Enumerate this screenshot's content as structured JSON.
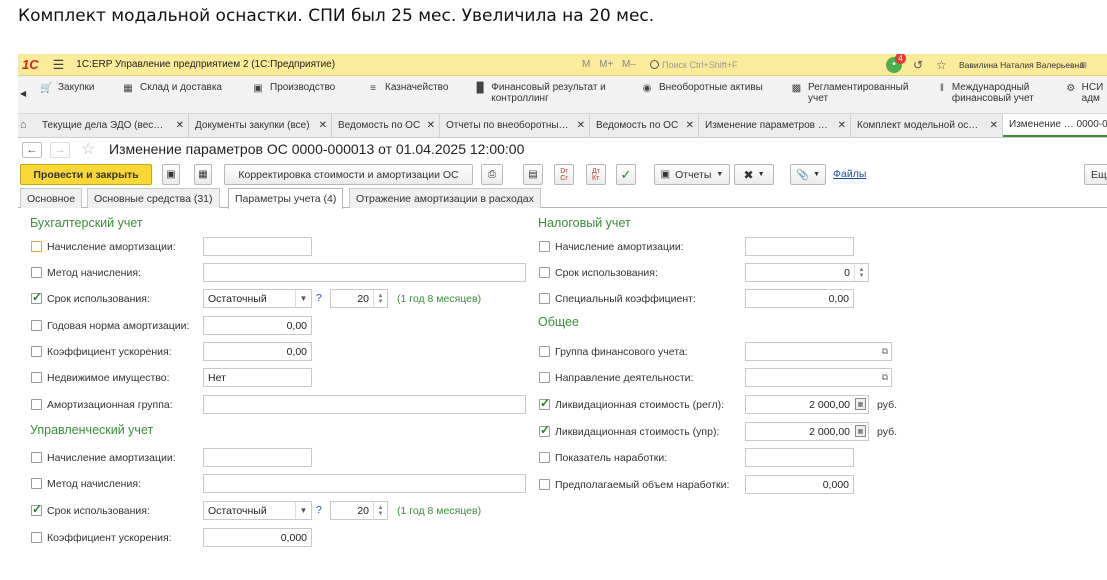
{
  "caption": "Комплект модальной оснастки. СПИ был 25 мес. Увеличила на 20 мес.",
  "topbar": {
    "logo": "1С",
    "menu_icon": "hamburger-icon",
    "title": "1С:ERP Управление предприятием 2  (1С:Предприятие)",
    "m_buttons": "M  M+  M–",
    "search_placeholder": "Поиск Ctrl+Shift+F",
    "notifications_count": "4",
    "user_name": "Вавилина Наталия Валерьевна"
  },
  "sections": [
    {
      "icon": "cart-icon",
      "label": "Закупки"
    },
    {
      "icon": "warehouse-icon",
      "label": "Склад и доставка"
    },
    {
      "icon": "factory-icon",
      "label": "Производство"
    },
    {
      "icon": "treasury-icon",
      "label": "Казначейство"
    },
    {
      "icon": "chart-icon",
      "label": "Финансовый результат и контроллинг"
    },
    {
      "icon": "car-icon",
      "label": "Внеоборотные активы"
    },
    {
      "icon": "report-icon",
      "label": "Регламентированный учет"
    },
    {
      "icon": "dr-cr-icon",
      "label": "Международный финансовый учет"
    },
    {
      "icon": "gear-icon",
      "label": "НСИ адм"
    }
  ],
  "open_tabs": [
    {
      "label": "Текущие дела ЭДО (вес…"
    },
    {
      "label": "Документы закупки (все)"
    },
    {
      "label": "Ведомость по ОС"
    },
    {
      "label": "Отчеты по внеоборотны…"
    },
    {
      "label": "Ведомость по ОС"
    },
    {
      "label": "Изменение параметров …"
    },
    {
      "label": "Комплект модельной ос…"
    },
    {
      "label": "Изменение … 0000-0"
    }
  ],
  "form": {
    "title": "Изменение параметров ОС 0000-000013 от 01.04.2025 12:00:00",
    "post_close": "Провести и закрыть",
    "correction": "Корректировка стоимости и амортизации ОС",
    "reports": "Отчеты",
    "files": "Файлы",
    "more": "Ещ",
    "tabs": [
      "Основное",
      "Основные средства (31)",
      "Параметры учета (4)",
      "Отражение амортизации в расходах"
    ]
  },
  "accounting": {
    "header": "Бухгалтерский учет",
    "depreciation": {
      "label": "Начисление амортизации:",
      "value": "",
      "checked": false
    },
    "method": {
      "label": "Метод начисления:",
      "value": "",
      "checked": false
    },
    "useful_life": {
      "label": "Срок использования:",
      "method": "Остаточный",
      "months": "20",
      "hint": "(1 год 8 месяцев)",
      "checked": true
    },
    "annual_rate": {
      "label": "Годовая норма амортизации:",
      "value": "0,00",
      "checked": false
    },
    "accel_coeff": {
      "label": "Коэффициент ускорения:",
      "value": "0,00",
      "checked": false
    },
    "real_estate": {
      "label": "Недвижимое имущество:",
      "value": "Нет",
      "checked": false
    },
    "group": {
      "label": "Амортизационная группа:",
      "value": "",
      "checked": false
    }
  },
  "management": {
    "header": "Управленческий учет",
    "depreciation": {
      "label": "Начисление амортизации:",
      "value": "",
      "checked": false
    },
    "method": {
      "label": "Метод начисления:",
      "value": "",
      "checked": false
    },
    "useful_life": {
      "label": "Срок использования:",
      "method": "Остаточный",
      "months": "20",
      "hint": "(1 год 8 месяцев)",
      "checked": true
    },
    "accel_coeff": {
      "label": "Коэффициент ускорения:",
      "value": "0,000",
      "checked": false
    }
  },
  "tax": {
    "header": "Налоговый учет",
    "depreciation": {
      "label": "Начисление амортизации:",
      "value": "",
      "checked": false
    },
    "useful_life": {
      "label": "Срок использования:",
      "value": "0",
      "checked": false
    },
    "special_coeff": {
      "label": "Специальный коэффициент:",
      "value": "0,00",
      "checked": false
    }
  },
  "general": {
    "header": "Общее",
    "fin_group": {
      "label": "Группа финансового учета:",
      "value": "",
      "checked": false
    },
    "activity": {
      "label": "Направление деятельности:",
      "value": "",
      "checked": false
    },
    "liq_regl": {
      "label": "Ликвидационная стоимость (регл):",
      "value": "2 000,00",
      "unit": "руб.",
      "checked": true
    },
    "liq_upr": {
      "label": "Ликвидационная стоимость (упр):",
      "value": "2 000,00",
      "unit": "руб.",
      "checked": true
    },
    "usage_indicator": {
      "label": "Показатель наработки:",
      "value": "",
      "checked": false
    },
    "expected_usage": {
      "label": "Предполагаемый объем наработки:",
      "value": "0,000",
      "checked": false
    }
  },
  "colors": {
    "accent_green": "#3b8d3b",
    "primary_yellow": "#f7d838",
    "topbar": "#fbec9c"
  }
}
